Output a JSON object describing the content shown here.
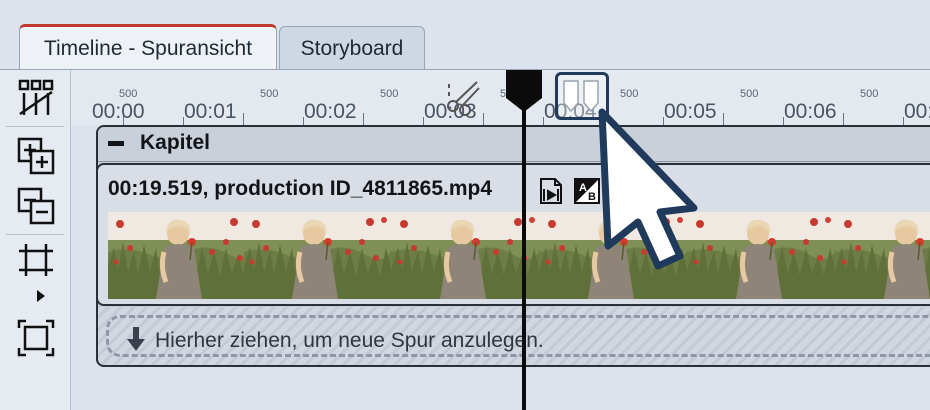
{
  "tabs": [
    {
      "label": "Timeline - Spuransicht",
      "active": true
    },
    {
      "label": "Storyboard",
      "active": false
    }
  ],
  "toolbar": {
    "icons": [
      "timeline-split-icon",
      "zoom-in-track-icon",
      "zoom-out-track-icon",
      "fit-width-icon",
      "fit-all-icon"
    ]
  },
  "ruler": {
    "labels": [
      "00:00",
      "00:01",
      "00:02",
      "00:03",
      "00:04",
      "00:05",
      "00:06",
      "00:0"
    ],
    "sublabel": "500"
  },
  "chapter": {
    "title": "Kapitel"
  },
  "clip": {
    "duration": "00:19.519,",
    "filename": "production ID_4811865.mp4"
  },
  "droptrack": {
    "text": "Hierher ziehen, um neue Spur anzulegen."
  },
  "colors": {
    "active_tab_accent": "#c0392b",
    "background": "#dde3ec",
    "marker_border": "#1f3a5a"
  }
}
